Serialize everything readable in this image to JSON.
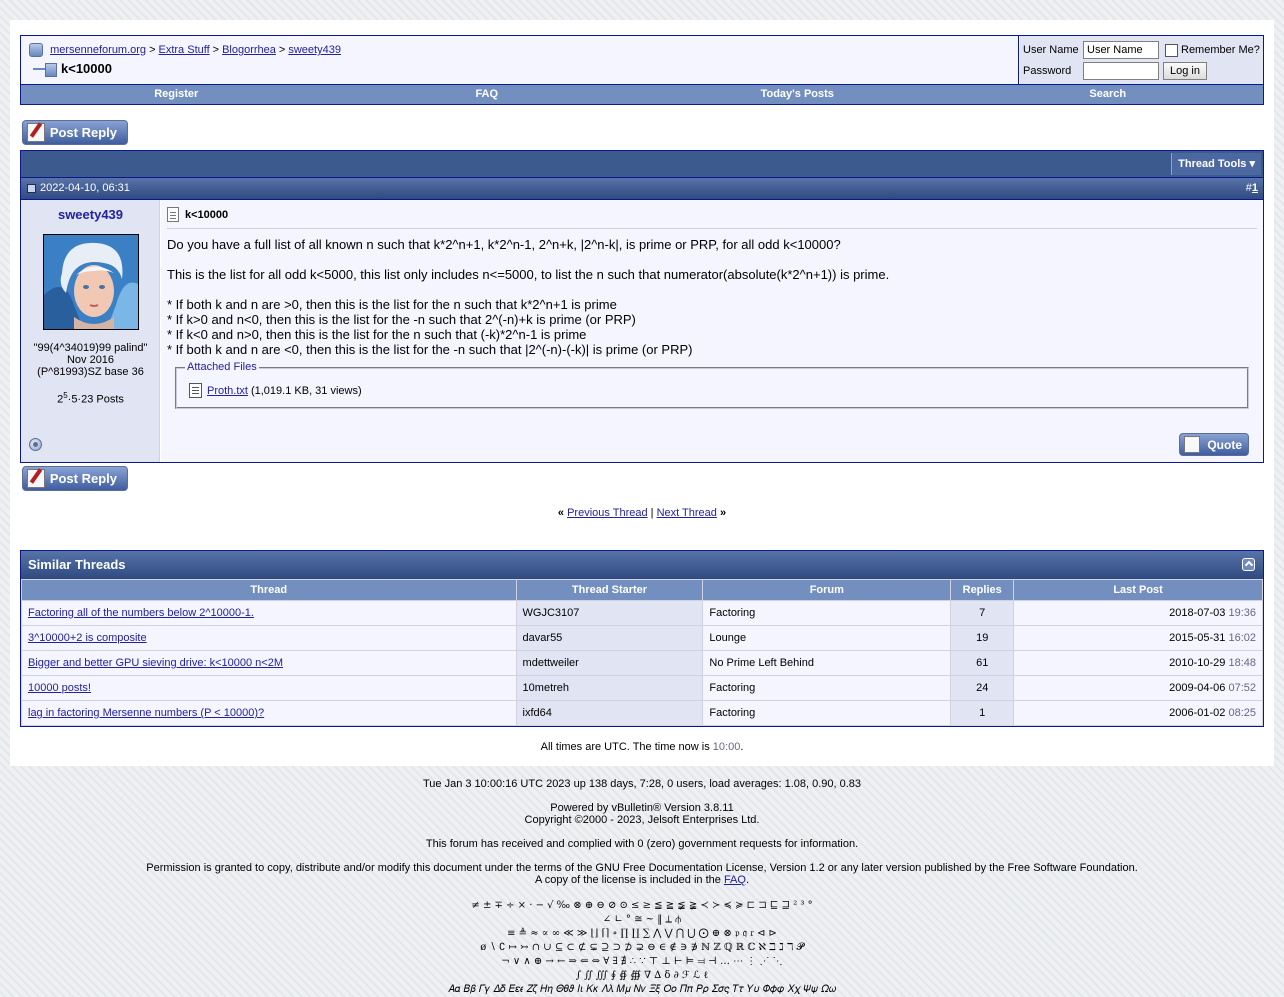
{
  "breadcrumb": {
    "items": [
      "mersenneforum.org",
      "Extra Stuff",
      "Blogorrhea",
      "sweety439"
    ],
    "separator": ">",
    "current": "k<10000"
  },
  "login": {
    "username_label": "User Name",
    "username_value": "User Name",
    "remember_label": "Remember Me?",
    "password_label": "Password",
    "login_button": "Log in"
  },
  "menu": [
    "Register",
    "FAQ",
    "Today's Posts",
    "Search"
  ],
  "post_reply_label": "Post Reply",
  "thread_tools_label": "Thread Tools",
  "post": {
    "date": "2022-04-10, 06:31",
    "number_prefix": "#",
    "number": "1",
    "username": "sweety439",
    "user_title_lines": [
      "\"99(4^34019)99 palind\"",
      "Nov 2016",
      "(P^81993)SZ base 36"
    ],
    "posts_base": "2",
    "posts_exp": "5",
    "posts_rest": "·5·23 Posts",
    "title": "k<10000",
    "paragraphs": [
      "Do you have a full list of all known n such that k*2^n+1, k*2^n-1, 2^n+k, |2^n-k|, is prime or PRP, for all odd k<10000?",
      "This is the list for all odd k<5000, this list only includes n<=5000, to list the n such that numerator(absolute(k*2^n+1)) is prime."
    ],
    "bullets": [
      "* If both k and n are >0, then this is the list for the n such that k*2^n+1 is prime",
      "* If k>0 and n<0, then this is the list for the -n such that 2^(-n)+k is prime (or PRP)",
      "* If k<0 and n>0, then this is the list for the n such that (-k)*2^n-1 is prime",
      "* If both k and n are <0, then this is the list for the -n such that |2^(-n)-(-k)| is prime (or PRP)"
    ],
    "attached_label": "Attached Files",
    "file_name": "Proth.txt",
    "file_info": "(1,019.1 KB, 31 views)",
    "quote_label": "Quote"
  },
  "thread_nav": {
    "left": "«",
    "prev": "Previous Thread",
    "sep": "|",
    "next": "Next Thread",
    "right": "»"
  },
  "similar": {
    "title": "Similar Threads",
    "columns": [
      "Thread",
      "Thread Starter",
      "Forum",
      "Replies",
      "Last Post"
    ],
    "rows": [
      {
        "thread": "Factoring all of the numbers below 2^10000-1.",
        "starter": "WGJC3107",
        "forum": "Factoring",
        "replies": "7",
        "date": "2018-07-03",
        "time": "19:36"
      },
      {
        "thread": "3^10000+2 is composite",
        "starter": "davar55",
        "forum": "Lounge",
        "replies": "19",
        "date": "2015-05-31",
        "time": "16:02"
      },
      {
        "thread": "Bigger and better GPU sieving drive: k<10000 n<2M",
        "starter": "mdettweiler",
        "forum": "No Prime Left Behind",
        "replies": "61",
        "date": "2010-10-29",
        "time": "18:48"
      },
      {
        "thread": "10000 posts!",
        "starter": "10metreh",
        "forum": "Factoring",
        "replies": "24",
        "date": "2009-04-06",
        "time": "07:52"
      },
      {
        "thread": "lag in factoring Mersenne numbers (P < 10000)?",
        "starter": "ixfd64",
        "forum": "Factoring",
        "replies": "1",
        "date": "2006-01-02",
        "time": "08:25"
      }
    ]
  },
  "timezone": {
    "text": "All times are UTC. The time now is",
    "time": "10:00",
    "end": "."
  },
  "footer": {
    "uptime": "Tue Jan 3 10:00:16 UTC 2023 up 138 days, 7:28, 0 users, load averages: 1.08, 0.90, 0.83",
    "powered": "Powered by vBulletin® Version 3.8.11",
    "copyright": "Copyright ©2000 - 2023, Jelsoft Enterprises Ltd.",
    "requests": "This forum has received and complied with 0 (zero) government requests for information.",
    "license": "Permission is granted to copy, distribute and/or modify this document under the terms of the GNU Free Documentation License, Version 1.2 or any later version published by the Free Software Foundation.",
    "license2_prefix": "A copy of the license is included in the",
    "license2_link": "FAQ",
    "license2_suffix": "."
  },
  "glyph_lines": [
    "≠ ± ∓ ÷ × · − √ ‰ ⊗ ⊕ ⊖ ⊘ ⊙ ≤ ≥ ≦ ≧ ≨ ≩ ≺ ≻ ≼ ≽ ⊏ ⊐ ⊑ ⊒ ² ³ °",
    "∠ ∟ ° ≅ ~ ‖ ⟂ ⫛",
    "≡ ≜ ≈ ∝ ∞ ≪ ≫ ⌊⌋ ⌈⌉ ∘ ∏ ∐ ∑ ⋀ ⋁ ⋂ ⋃ ⨀ ⊕ ⊗ 𝔭 𝔮 𝔯 ⊲ ⊳",
    "ø ∖ ∁ ↦ ↣ ∩ ∪ ⊆ ⊂ ⊄ ⊊ ⊇ ⊃ ⊅ ⊋ ⊖ ∈ ∉ ∋ ∌ ℕ ℤ ℚ ℝ ℂ ℵ ℶ ℷ ℸ 𝓟",
    "¬ ∨ ∧ ⊕ → ← ⇒ ⇐ ⇔ ∀ ∃ ∄ ∴ ∵ ⊤ ⊥ ⊢ ⊨ ⫤ ⊣ … ⋯ ⋮ ⋰ ⋱",
    "∫ ∬ ∭ ∮ ∯ ∰ ∇ ∆ δ ∂ ℱ ℒ ℓ",
    "𝛢𝛼 𝛣𝛽 𝛤𝛾 𝛥𝛿 𝛦𝜀𝜖 𝛧𝜁 𝛨𝜂 𝛩𝜃𝜗 𝛪𝜄 𝛫𝜅 𝛬𝜆 𝛭𝜇 𝛮𝜈 𝛯𝜉 𝛰𝜊 𝛱𝜋 𝛲𝜌 𝛴𝜎𝜍 𝛵𝜏 𝛶𝜐 𝛷𝜙𝜑 𝛸𝜒 𝛹𝜓 𝛺𝜔"
  ],
  "colors": {
    "navy_border": "#0b198c",
    "header_blue": "#3d5a8f",
    "menu_blue": "#738fbf",
    "alt1": "#f5f5ff",
    "alt2": "#e1e4f2",
    "link": "#22229c"
  }
}
